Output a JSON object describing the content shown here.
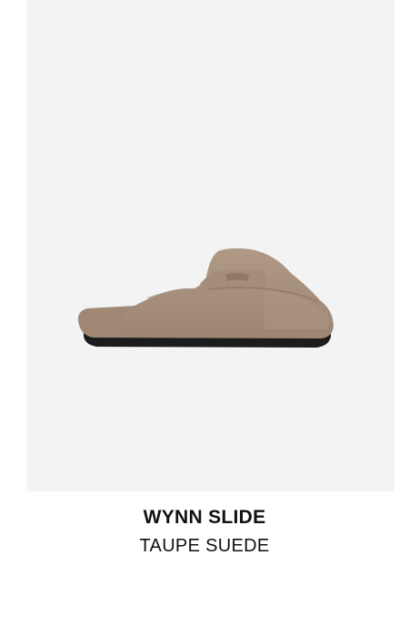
{
  "product": {
    "name": "WYNN SLIDE",
    "color_label": "TAUPE SUEDE",
    "image_icon": "shoe-image",
    "swatch_color": "#a58f7c"
  }
}
